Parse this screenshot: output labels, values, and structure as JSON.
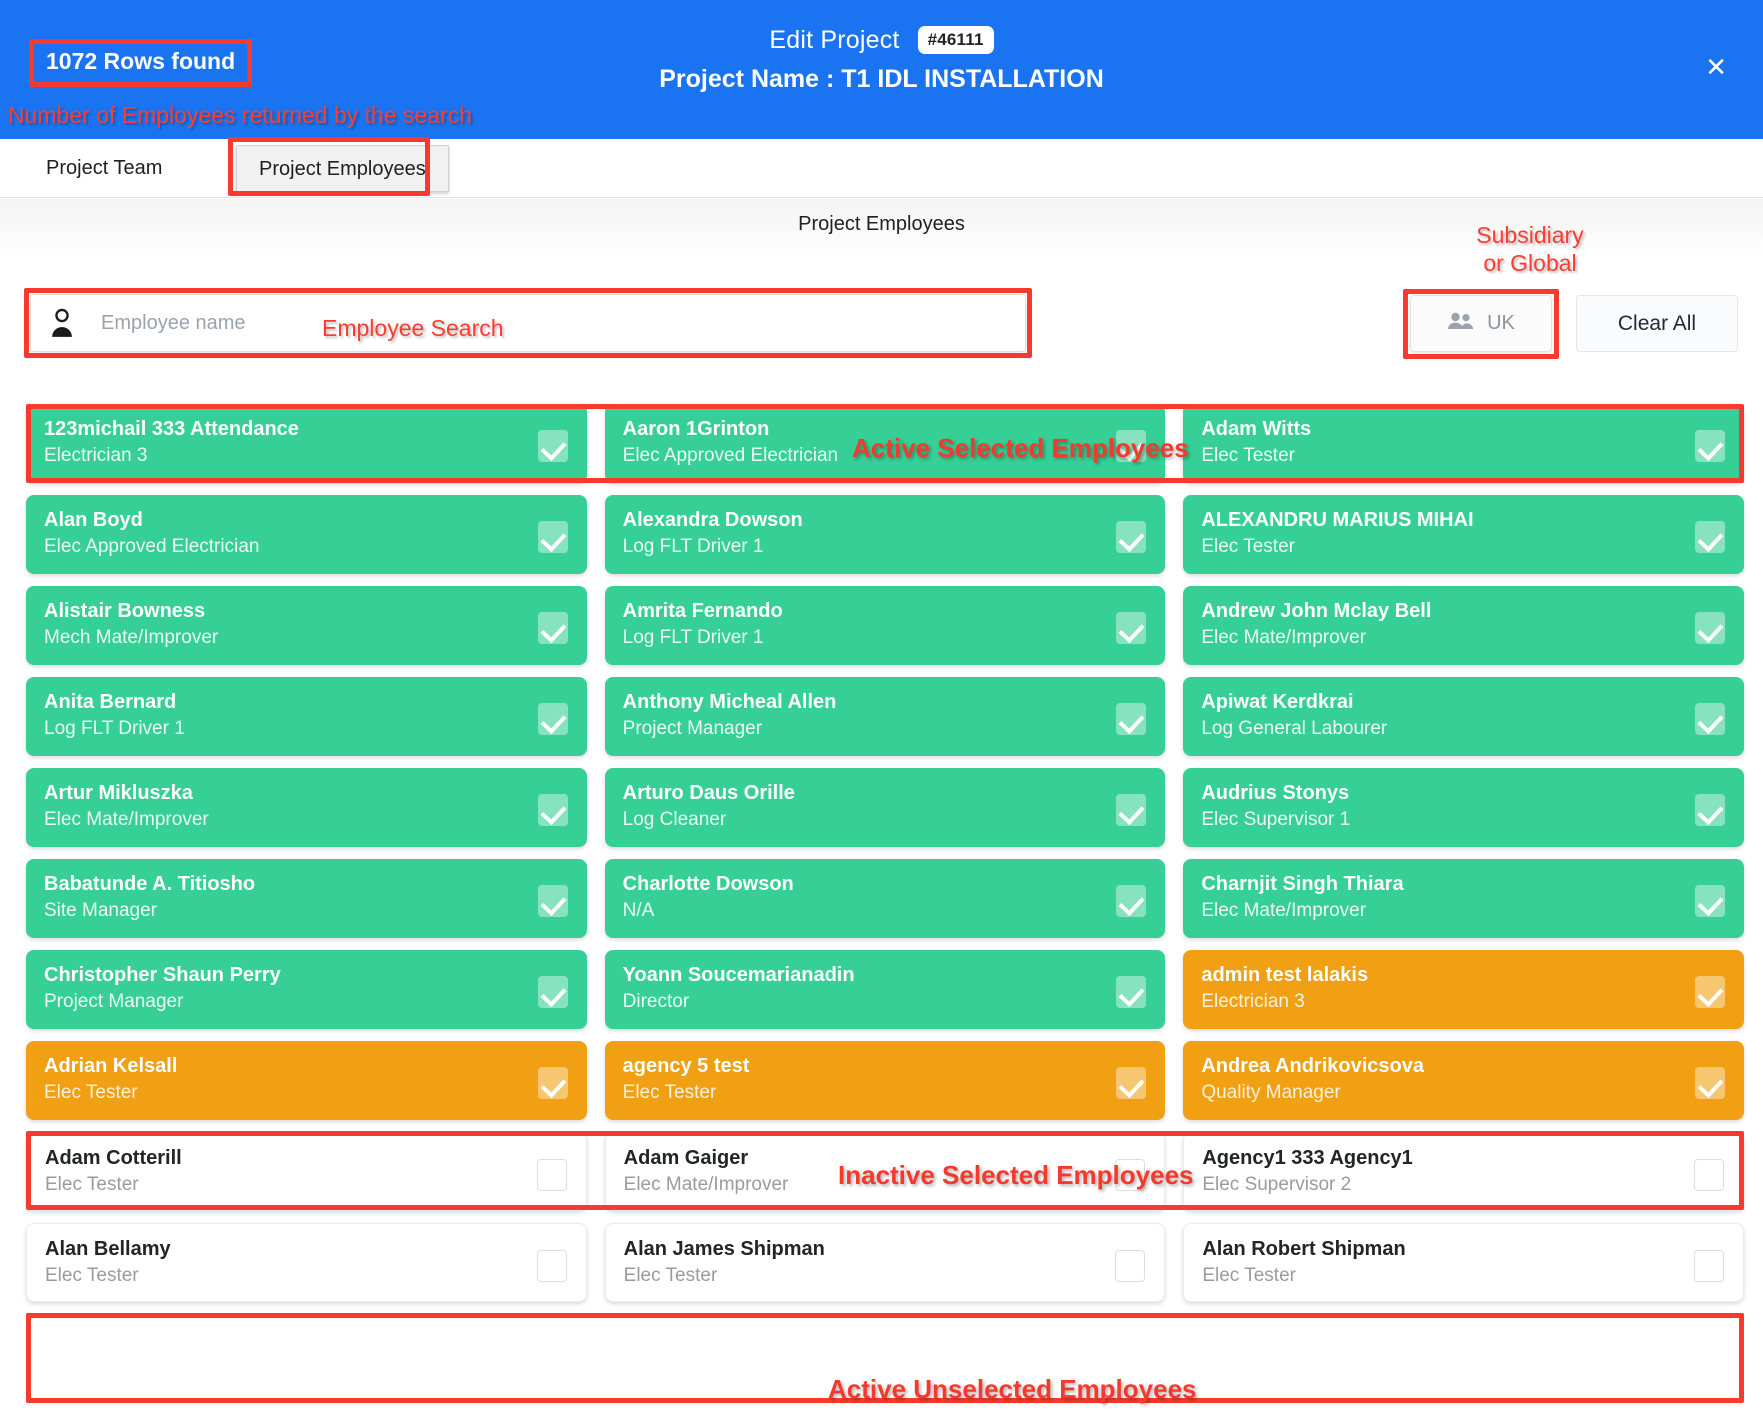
{
  "header": {
    "title": "Edit Project",
    "project_id": "#46111",
    "project_name_label": "Project Name : T1 IDL INSTALLATION",
    "close_icon": "close-icon",
    "rows_found": "1072 Rows found",
    "rows_found_note": "Number of Employees returned by the search"
  },
  "tabs": [
    {
      "label": "Project Team",
      "active": false
    },
    {
      "label": "Project Employees",
      "active": true
    }
  ],
  "section": {
    "title": "Project Employees"
  },
  "search": {
    "placeholder": "Employee name",
    "value": "",
    "icon": "person-icon",
    "note": "Employee Search"
  },
  "subsidiary": {
    "label": "UK",
    "icon": "people-icon",
    "note_line1": "Subsidiary",
    "note_line2": "or Global"
  },
  "clear_all": {
    "label": "Clear All"
  },
  "annotations": {
    "active_selected": "Active Selected Employees",
    "inactive_selected": "Inactive Selected Employees",
    "active_unselected": "Active Unselected Employees"
  },
  "colors": {
    "header_blue": "#1a73f0",
    "active_selected_green": "#36cf95",
    "inactive_selected_orange": "#f0a012",
    "annotation_red": "#f5392c",
    "unselected_white": "#ffffff"
  },
  "employees": [
    {
      "name": "123michail 333 Attendance",
      "role": "Electrician 3",
      "state": "green",
      "checked": true
    },
    {
      "name": "Aaron 1Grinton",
      "role": "Elec Approved Electrician",
      "state": "green",
      "checked": true
    },
    {
      "name": "Adam Witts",
      "role": "Elec Tester",
      "state": "green",
      "checked": true
    },
    {
      "name": "Alan Boyd",
      "role": "Elec Approved Electrician",
      "state": "green",
      "checked": true
    },
    {
      "name": "Alexandra Dowson",
      "role": "Log FLT Driver 1",
      "state": "green",
      "checked": true
    },
    {
      "name": "ALEXANDRU MARIUS MIHAI",
      "role": "Elec Tester",
      "state": "green",
      "checked": true
    },
    {
      "name": "Alistair Bowness",
      "role": "Mech Mate/Improver",
      "state": "green",
      "checked": true
    },
    {
      "name": "Amrita Fernando",
      "role": "Log FLT Driver 1",
      "state": "green",
      "checked": true
    },
    {
      "name": "Andrew John Mclay Bell",
      "role": "Elec Mate/Improver",
      "state": "green",
      "checked": true
    },
    {
      "name": "Anita Bernard",
      "role": "Log FLT Driver 1",
      "state": "green",
      "checked": true
    },
    {
      "name": "Anthony Micheal Allen",
      "role": "Project Manager",
      "state": "green",
      "checked": true
    },
    {
      "name": "Apiwat Kerdkrai",
      "role": "Log General Labourer",
      "state": "green",
      "checked": true
    },
    {
      "name": "Artur Mikluszka",
      "role": "Elec Mate/Improver",
      "state": "green",
      "checked": true
    },
    {
      "name": "Arturo Daus Orille",
      "role": "Log Cleaner",
      "state": "green",
      "checked": true
    },
    {
      "name": "Audrius Stonys",
      "role": "Elec Supervisor 1",
      "state": "green",
      "checked": true
    },
    {
      "name": "Babatunde A. Titiosho",
      "role": "Site Manager",
      "state": "green",
      "checked": true
    },
    {
      "name": "Charlotte Dowson",
      "role": "N/A",
      "state": "green",
      "checked": true
    },
    {
      "name": "Charnjit Singh Thiara",
      "role": "Elec Mate/Improver",
      "state": "green",
      "checked": true
    },
    {
      "name": "Christopher Shaun Perry",
      "role": "Project Manager",
      "state": "green",
      "checked": true
    },
    {
      "name": "Yoann Soucemarianadin",
      "role": "Director",
      "state": "green",
      "checked": true
    },
    {
      "name": "admin test lalakis",
      "role": "Electrician 3",
      "state": "orange",
      "checked": true
    },
    {
      "name": "Adrian Kelsall",
      "role": "Elec Tester",
      "state": "orange",
      "checked": true
    },
    {
      "name": "agency 5 test",
      "role": "Elec Tester",
      "state": "orange",
      "checked": true
    },
    {
      "name": "Andrea Andrikovicsova",
      "role": "Quality Manager",
      "state": "orange",
      "checked": true
    },
    {
      "name": "Adam Cotterill",
      "role": "Elec Tester",
      "state": "plain",
      "checked": false
    },
    {
      "name": "Adam Gaiger",
      "role": "Elec Mate/Improver",
      "state": "plain",
      "checked": false
    },
    {
      "name": "Agency1 333 Agency1",
      "role": "Elec Supervisor 2",
      "state": "plain",
      "checked": false
    },
    {
      "name": "Alan Bellamy",
      "role": "Elec Tester",
      "state": "plain",
      "checked": false
    },
    {
      "name": "Alan James Shipman",
      "role": "Elec Tester",
      "state": "plain",
      "checked": false
    },
    {
      "name": "Alan Robert Shipman",
      "role": "Elec Tester",
      "state": "plain",
      "checked": false
    }
  ]
}
